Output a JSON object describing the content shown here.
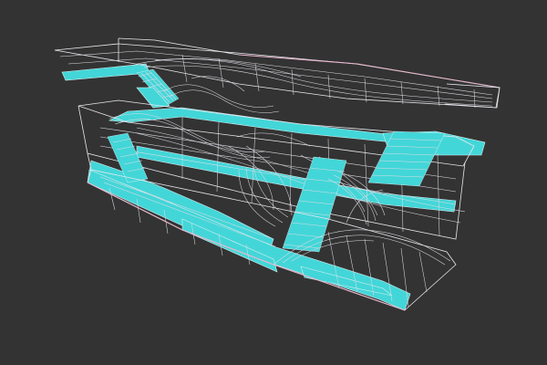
{
  "viewport": {
    "background_color": "#333333",
    "wire_color": "#e8e8ee",
    "surface_color": "#43d6d8",
    "edge_accent_color": "#e7b7cd"
  }
}
